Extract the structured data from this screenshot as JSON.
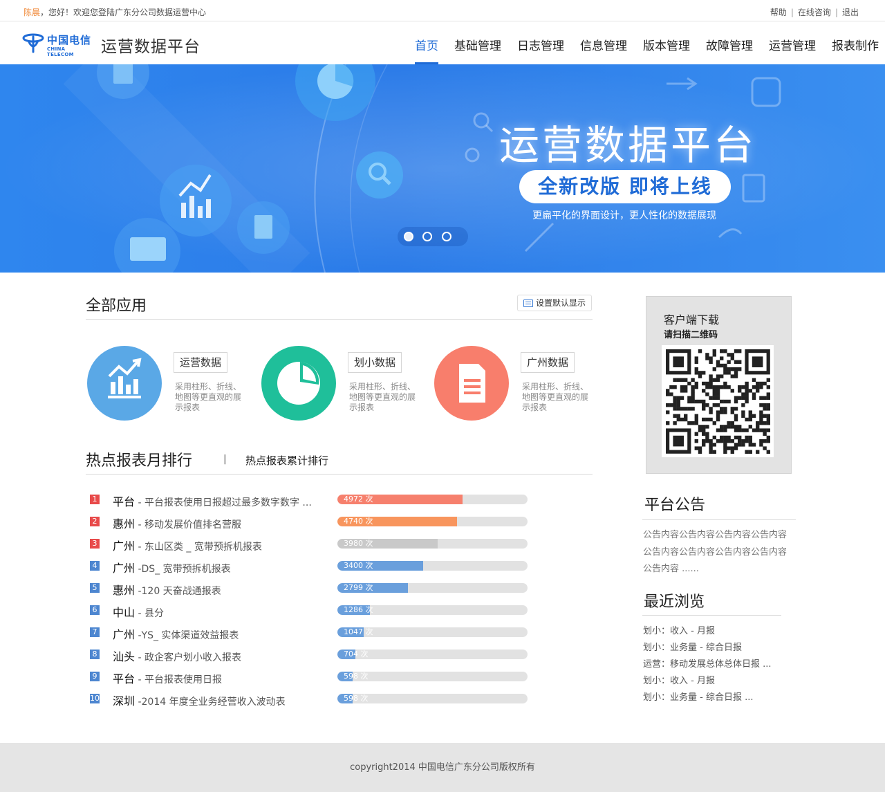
{
  "topbar": {
    "user": "陈晨",
    "welcome": "，您好！欢迎您登陆广东分公司数据运营中心",
    "links": [
      "帮助",
      "在线咨询",
      "退出"
    ]
  },
  "header": {
    "logo_cn": "中国电信",
    "logo_en": "CHINA TELECOM",
    "title": "运营数据平台",
    "nav": [
      "首页",
      "基础管理",
      "日志管理",
      "信息管理",
      "版本管理",
      "故障管理",
      "运营管理",
      "报表制作"
    ],
    "active_nav": 0
  },
  "banner": {
    "title": "运营数据平台",
    "badge": "全新改版  即将上线",
    "subtitle": "更扁平化的界面设计，更人性化的数据展现",
    "slides": 3,
    "active_slide": 0
  },
  "apps": {
    "title": "全部应用",
    "set_default_label": "设置默认显示",
    "items": [
      {
        "label": "运营数据",
        "desc": "采用柱形、折线、地图等更直观的展示报表",
        "color": "#5aa8e6",
        "icon": "bar-chart-icon"
      },
      {
        "label": "划小数据",
        "desc": "采用柱形、折线、地图等更直观的展示报表",
        "color": "#1fbf9a",
        "icon": "pie-chart-icon"
      },
      {
        "label": "广州数据",
        "desc": "采用柱形、折线、地图等更直观的展示报表",
        "color": "#f87e6c",
        "icon": "document-icon"
      }
    ]
  },
  "ranking": {
    "tab_monthly": "热点报表月排行",
    "separator": "|",
    "tab_total": "热点报表累计排行",
    "max": 7540,
    "rows": [
      {
        "rank": "1",
        "city": "平台",
        "title": " - 平台报表使用日报超过最多数字数字 ...",
        "count": 4972,
        "label": "4972 次",
        "bar": "#f6806d",
        "badge": "#e84a4a"
      },
      {
        "rank": "2",
        "city": "惠州",
        "title": " - 移动发展价值排名营服",
        "count": 4740,
        "label": "4740 次",
        "bar": "#f8955d",
        "badge": "#e84a4a"
      },
      {
        "rank": "3",
        "city": "广州",
        "title": " - 东山区类 _ 宽带预拆机报表",
        "count": 3980,
        "label": "3980 次",
        "bar": "#c9c9c9",
        "badge": "#e84a4a"
      },
      {
        "rank": "4",
        "city": "广州",
        "title": " -DS_ 宽带预拆机报表",
        "count": 3400,
        "label": "3400 次",
        "bar": "#6a9fdc",
        "badge": "#4d86d0"
      },
      {
        "rank": "5",
        "city": "惠州",
        "title": " -120 天奋战通报表",
        "count": 2799,
        "label": "2799 次",
        "bar": "#6a9fdc",
        "badge": "#4d86d0"
      },
      {
        "rank": "6",
        "city": "中山",
        "title": " - 县分",
        "count": 1286,
        "label": "1286 次",
        "bar": "#6a9fdc",
        "badge": "#4d86d0"
      },
      {
        "rank": "7",
        "city": "广州",
        "title": " -YS_ 实体渠道效益报表",
        "count": 1047,
        "label": "1047 次",
        "bar": "#6a9fdc",
        "badge": "#4d86d0"
      },
      {
        "rank": "8",
        "city": "汕头",
        "title": " - 政企客户划小收入报表",
        "count": 704,
        "label": "704 次",
        "bar": "#6a9fdc",
        "badge": "#4d86d0"
      },
      {
        "rank": "9",
        "city": "平台",
        "title": " - 平台报表使用日报",
        "count": 598,
        "label": "598 次",
        "bar": "#6a9fdc",
        "badge": "#4d86d0"
      },
      {
        "rank": "10",
        "city": "深圳",
        "title": " -2014 年度全业务经营收入波动表",
        "count": 598,
        "label": "598 次",
        "bar": "#6a9fdc",
        "badge": "#4d86d0"
      }
    ]
  },
  "download": {
    "title": "客户端下载",
    "subtitle": "请扫描二维码"
  },
  "notice": {
    "title": "平台公告",
    "content": "公告内容公告内容公告内容公告内容公告内容公告内容公告内容公告内容公告内容 ......"
  },
  "recent": {
    "title": "最近浏览",
    "items": [
      "划小：收入 - 月报",
      "划小：业务量 - 综合日报",
      "运营：移动发展总体总体日报 ...",
      "划小：收入 - 月报",
      "划小：业务量 - 综合日报 ..."
    ]
  },
  "footer": {
    "copyright": "copyright2014 中国电信广东分公司版权所有"
  },
  "colors": {
    "brand": "#1f6bd6",
    "banner": "#2b7be8"
  }
}
